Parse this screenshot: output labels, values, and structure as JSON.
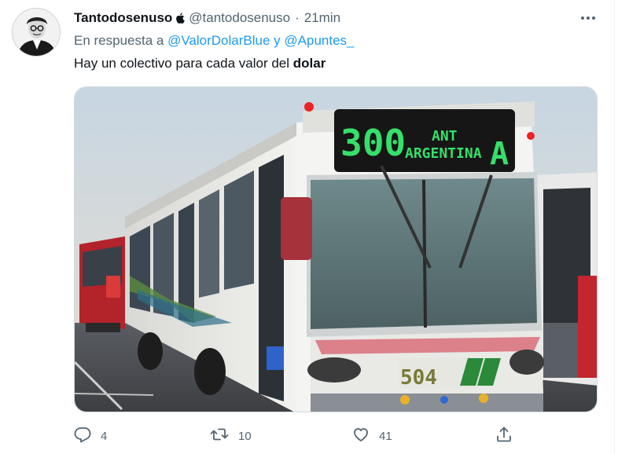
{
  "tweet": {
    "author": {
      "display_name": "Tantodosenuso",
      "handle": "@tantodosenuso",
      "separator": "·",
      "time": "21min"
    },
    "reply_context": {
      "prefix": "En respuesta a",
      "mention_1": "@ValorDolarBlue",
      "conjunction": "y",
      "mention_2": "@Apuntes_"
    },
    "text": {
      "main": "Hay un colectivo para cada valor del",
      "bold": "dolar"
    },
    "media": {
      "sign_number": "300",
      "sign_line_1": "ANT",
      "sign_line_2": "ARGENTINA",
      "sign_letter": "A",
      "plate_number": "504"
    },
    "actions": {
      "replies": "4",
      "retweets": "10",
      "likes": "41"
    },
    "colors": {
      "link": "#1d9bf0",
      "secondary_text": "#536471",
      "sign_led": "#35e06a"
    },
    "icons": [
      "apple-icon",
      "more-icon",
      "reply-icon",
      "retweet-icon",
      "like-icon",
      "share-icon"
    ]
  }
}
